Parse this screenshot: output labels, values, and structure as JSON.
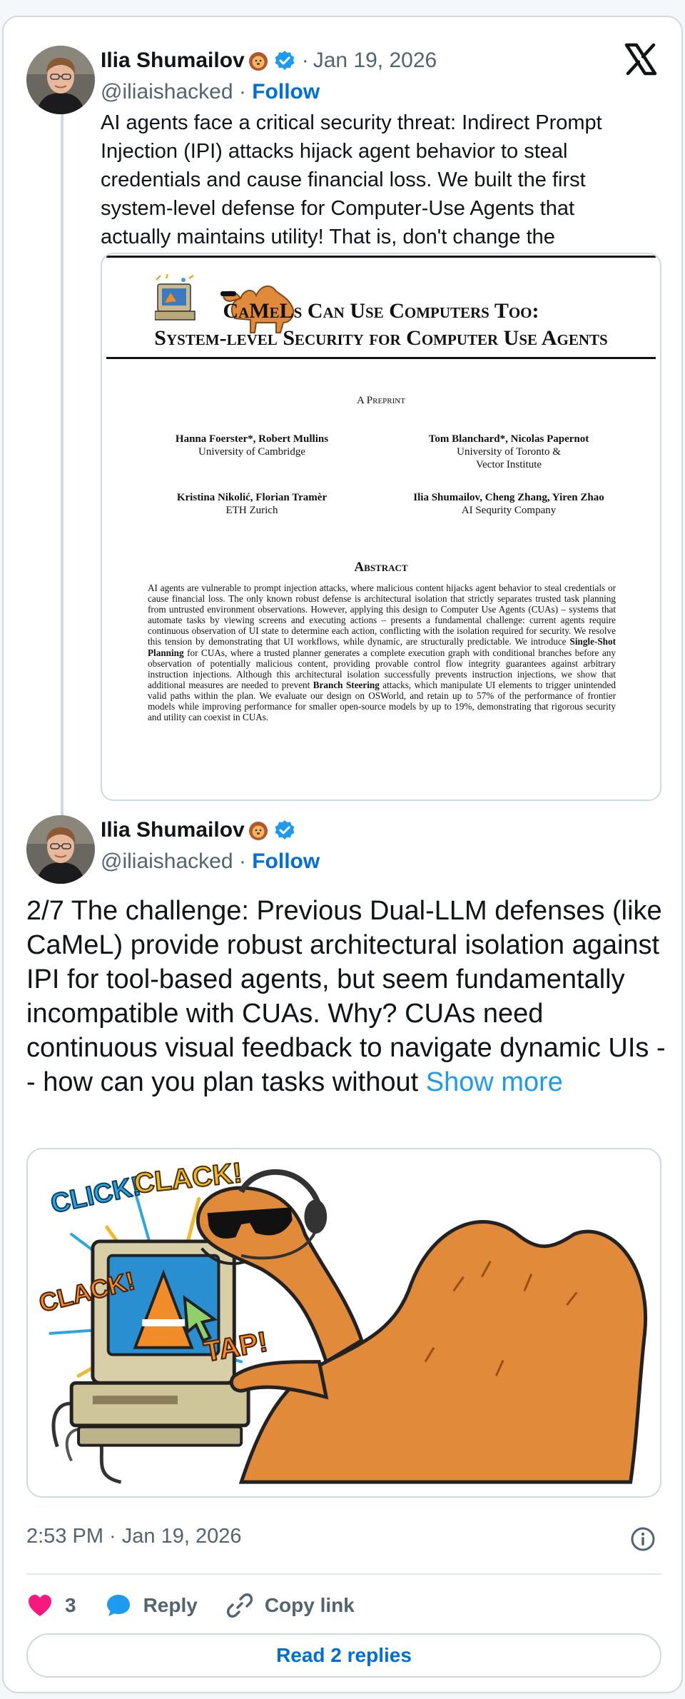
{
  "tweet1": {
    "author_name": "Ilia Shumailov",
    "handle": "@iliaishacked",
    "date": "Jan 19, 2026",
    "follow_label": "Follow",
    "text": "AI agents face a critical security threat: Indirect Prompt Injection (IPI) attacks hijack agent behavior to steal credentials and cause financial loss. We built the first system-level defense for Computer-Use Agents that actually maintains utility! That is, don't change the",
    "paper": {
      "title_line1": "CaMeLs Can Use Computers Too:",
      "title_line2": "System-level Security for Computer Use Agents",
      "preprint": "A Preprint",
      "authors": [
        {
          "names": "Hanna Foerster*, Robert Mullins",
          "affiliation": "University of Cambridge"
        },
        {
          "names": "Tom Blanchard*, Nicolas Papernot",
          "affiliation": "University of Toronto & Vector Institute"
        },
        {
          "names": "Kristina Nikolić, Florian Tramèr",
          "affiliation": "ETH Zurich"
        },
        {
          "names": "Ilia Shumailov, Cheng Zhang, Yiren Zhao",
          "affiliation": "AI Sequrity Company"
        }
      ],
      "abstract_heading": "Abstract",
      "abstract_part1": "AI agents are vulnerable to prompt injection attacks, where malicious content hijacks agent behavior to steal credentials or cause financial loss. The only known robust defense is architectural isolation that strictly separates trusted task planning from untrusted environment observations. However, applying this design to Computer Use Agents (CUAs) – systems that automate tasks by viewing screens and executing actions – presents a fundamental challenge: current agents require continuous observation of UI state to determine each action, conflicting with the isolation required for security. We resolve this tension by demonstrating that UI workflows, while dynamic, are structurally predictable. We introduce ",
      "abstract_bold1": "Single-Shot Planning",
      "abstract_part2": " for CUAs, where a trusted planner generates a complete execution graph with conditional branches before any observation of potentially malicious content, providing provable control flow integrity guarantees against arbitrary instruction injections. Although this architectural isolation successfully prevents instruction injections, we show that additional measures are needed to prevent ",
      "abstract_bold2": "Branch Steering",
      "abstract_part3": " attacks, which manipulate UI elements to trigger unintended valid paths within the plan. We evaluate our design on OSWorld, and retain up to 57% of the performance of frontier models while improving performance for smaller open-source models by up to 19%, demonstrating that rigorous security and utility can coexist in CUAs."
    }
  },
  "tweet2": {
    "author_name": "Ilia Shumailov",
    "handle": "@iliaishacked",
    "follow_label": "Follow",
    "text": "2/7 The challenge: Previous Dual-LLM defenses (like CaMeL) provide robust architectural isolation against IPI for tool-based agents, but seem fundamentally incompatible with CUAs. Why? CUAs need continuous visual feedback to navigate dynamic UIs -- how can you plan tasks without ",
    "show_more": "Show more",
    "image_words": [
      "CLICK!",
      "CLACK!",
      "CLACK!",
      "TAP!"
    ],
    "timestamp": "2:53 PM · Jan 19, 2026"
  },
  "actions": {
    "like_count": "3",
    "reply_label": "Reply",
    "copy_link_label": "Copy link",
    "read_replies_label": "Read 2 replies"
  },
  "colors": {
    "accent": "#1d9bf0",
    "follow": "#006fd6",
    "like": "#f91880",
    "muted": "#536471"
  },
  "icons": [
    "verified-badge-icon",
    "lion-emoji-icon",
    "x-logo-icon",
    "info-icon",
    "heart-icon",
    "reply-bubble-icon",
    "link-icon"
  ]
}
